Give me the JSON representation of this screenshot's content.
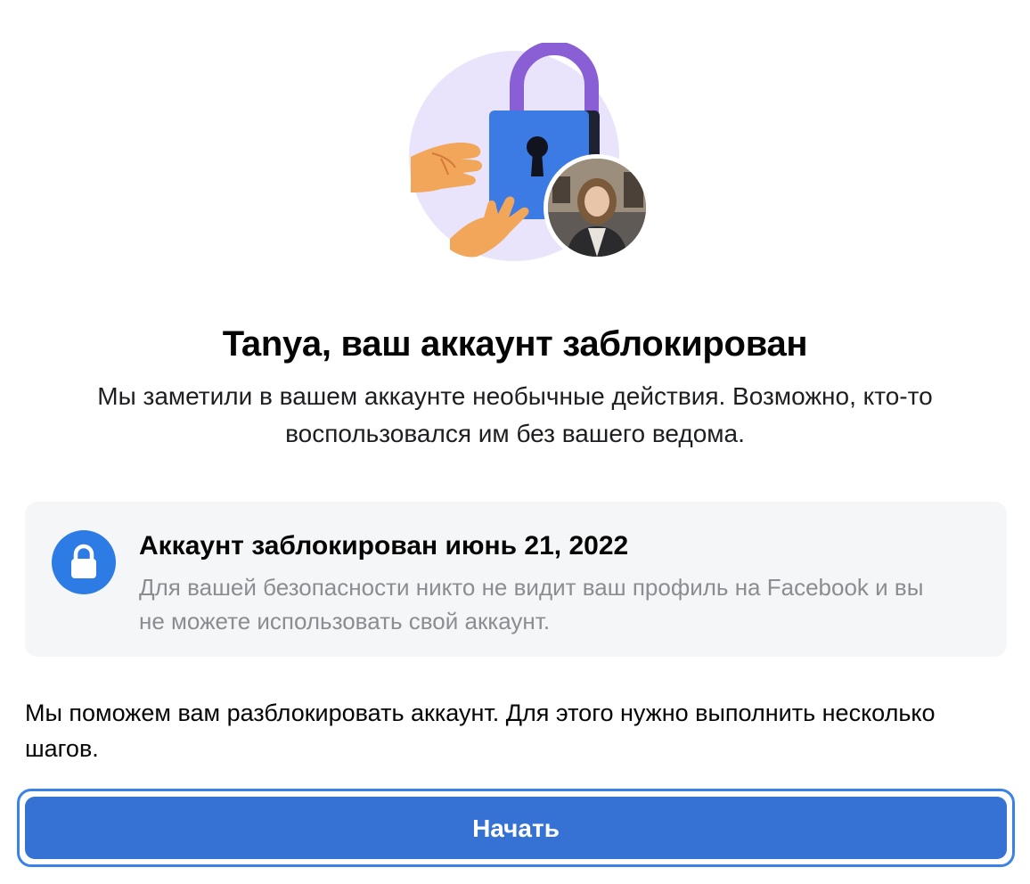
{
  "header": {
    "title": "Tanya, ваш аккаунт заблокирован",
    "subtitle": "Мы заметили в вашем аккаунте необычные действия. Возможно, кто-то воспользовался им без вашего ведома."
  },
  "illustration": {
    "main_icon": "padlock-with-hands",
    "avatar": "profile-photo"
  },
  "info_card": {
    "icon": "lock-icon",
    "heading": "Аккаунт заблокирован июнь 21, 2022",
    "body": "Для вашей безопасности никто не видит ваш профиль на Facebook и вы не можете использовать свой аккаунт."
  },
  "help_text": "Мы поможем вам разблокировать аккаунт. Для этого нужно выполнить несколько шагов.",
  "actions": {
    "start_label": "Начать"
  },
  "colors": {
    "accent": "#3672d4",
    "lock_blue": "#3d7be4",
    "shackle_purple": "#8a5fd6",
    "hands_orange": "#f2a65a",
    "circle_lavender": "#e9e4fb"
  }
}
